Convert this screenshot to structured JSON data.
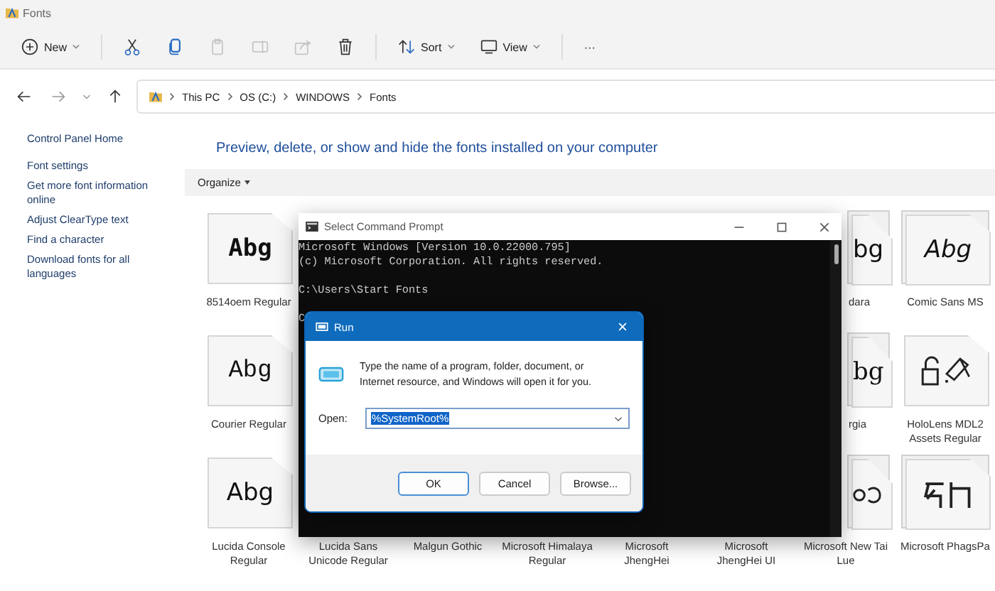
{
  "window": {
    "title": "Fonts"
  },
  "toolbar": [
    {
      "kind": "new",
      "label": "New",
      "disabled": false
    },
    {
      "kind": "cut",
      "disabled": false
    },
    {
      "kind": "copy",
      "disabled": false
    },
    {
      "kind": "paste",
      "disabled": true
    },
    {
      "kind": "rename",
      "disabled": true
    },
    {
      "kind": "share",
      "disabled": true
    },
    {
      "kind": "delete",
      "disabled": false
    },
    {
      "kind": "sort",
      "label": "Sort",
      "disabled": false
    },
    {
      "kind": "view",
      "label": "View",
      "disabled": false
    },
    {
      "kind": "more",
      "label": "···",
      "disabled": false
    }
  ],
  "breadcrumb": [
    "This PC",
    "OS (C:)",
    "WINDOWS",
    "Fonts"
  ],
  "sidebar": {
    "items": [
      "Control Panel Home",
      "Font settings",
      "Get more font information online",
      "Adjust ClearType text",
      "Find a character",
      "Download fonts for all languages"
    ]
  },
  "heading": "Preview, delete, or show and hide the fonts installed on your computer",
  "organize": "Organize",
  "font_rows": [
    [
      {
        "kind": "pixel",
        "preview": "Abg",
        "label": "8514oem Regular",
        "stacked": false
      },
      null,
      null,
      null,
      null,
      null,
      {
        "kind": "sans",
        "preview": "bg",
        "label": "dara",
        "label_cut": true,
        "stacked": true
      },
      {
        "kind": "comic",
        "preview": "Abg",
        "label": "Comic Sans MS",
        "stacked": true
      }
    ],
    [
      {
        "kind": "courier",
        "preview": "Abg",
        "label": "Courier Regular",
        "stacked": false
      },
      null,
      null,
      null,
      null,
      null,
      {
        "kind": "serif",
        "preview": "bg",
        "label": "rgia",
        "label_cut": true,
        "stacked": true
      },
      {
        "kind": "lock",
        "label": "HoloLens MDL2 Assets Regular",
        "stacked": false
      }
    ],
    [
      {
        "kind": "sans",
        "preview": "Abg",
        "label": "Lucida Console Regular",
        "stacked": false
      },
      {
        "label": "Lucida Sans Unicode Regular"
      },
      {
        "label": "Malgun Gothic"
      },
      {
        "label": "Microsoft Himalaya Regular"
      },
      {
        "label": "Microsoft JhengHei"
      },
      {
        "label": "Microsoft JhengHei UI"
      },
      {
        "kind": "tailue",
        "label": "Microsoft New Tai Lue",
        "stacked": true
      },
      {
        "kind": "phags",
        "label": "Microsoft PhagsPa",
        "stacked": true
      }
    ]
  ],
  "cmd": {
    "title": "Select Command Prompt",
    "lines": [
      {
        "text": "Microsoft Windows [Version 10.0.22000.795]",
        "blank_before": false
      },
      {
        "text": "(c) Microsoft Corporation. All rights reserved.",
        "blank_before": false
      },
      {
        "text": "C:\\Users\\Start Fonts",
        "blank_before": true
      },
      {
        "text": "C",
        "blank_before": true
      }
    ]
  },
  "run": {
    "title": "Run",
    "message": "Type the name of a program, folder, document, or Internet resource, and Windows will open it for you.",
    "open_label": "Open:",
    "value": "%SystemRoot%",
    "value_selected": true,
    "buttons": [
      {
        "label": "OK",
        "default": true
      },
      {
        "label": "Cancel",
        "default": false
      },
      {
        "label": "Browse...",
        "default": false
      }
    ]
  }
}
